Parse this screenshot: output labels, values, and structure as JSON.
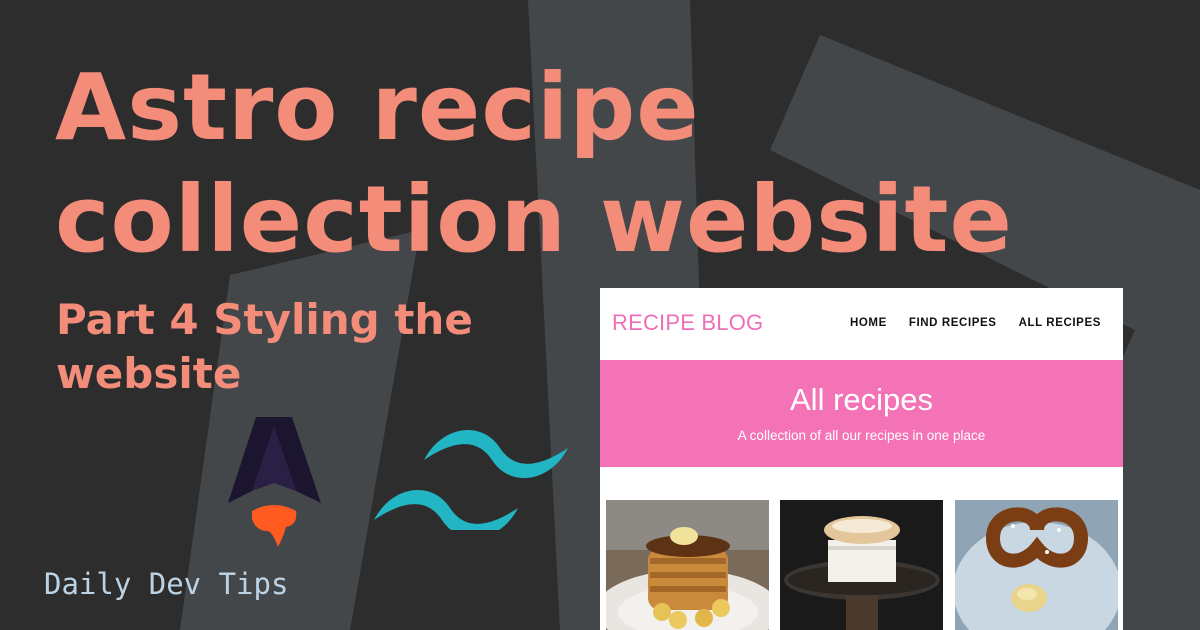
{
  "headline": {
    "title": "Astro recipe collection website",
    "subtitle": "Part 4 Styling the website"
  },
  "logos": {
    "astro": "astro-logo-icon",
    "tailwind": "tailwind-logo-icon"
  },
  "brand": {
    "text": "Daily Dev Tips"
  },
  "colors": {
    "background": "#2d2d2d",
    "accent": "#f48c7a",
    "brand_text": "#bcd3e6",
    "pink": "#f472b6",
    "tailwind": "#22b5c4"
  },
  "mockup": {
    "logo": "RECIPE BLOG",
    "nav": [
      "HOME",
      "FIND RECIPES",
      "ALL RECIPES"
    ],
    "hero": {
      "title": "All recipes",
      "subtitle": "A collection of all our recipes in one place"
    },
    "cards": [
      {
        "image": "pancakes-photo"
      },
      {
        "image": "souffle-photo"
      },
      {
        "image": "pretzel-photo"
      }
    ]
  }
}
